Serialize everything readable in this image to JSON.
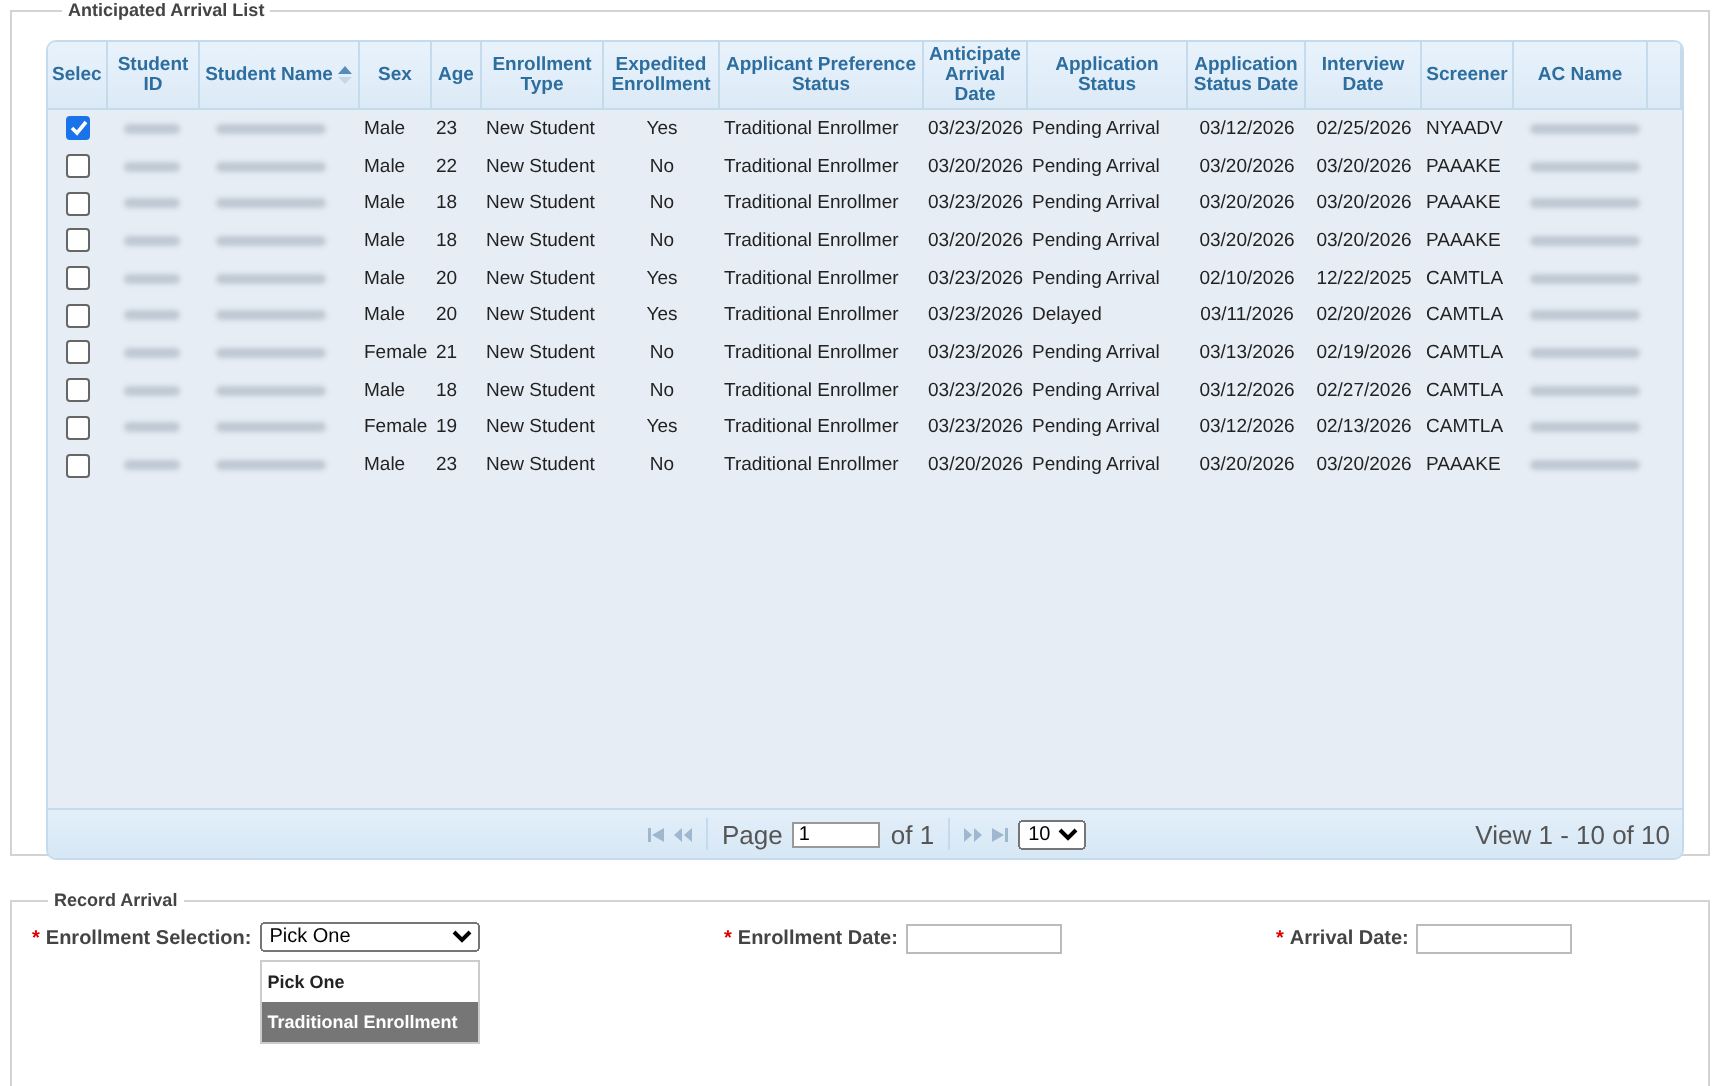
{
  "arrival_list": {
    "legend": "Anticipated Arrival List",
    "columns": [
      {
        "label": "Selec",
        "sorted": false
      },
      {
        "label": "Student ID",
        "sorted": false
      },
      {
        "label": "Student Name",
        "sorted": true
      },
      {
        "label": "Sex",
        "sorted": false
      },
      {
        "label": "Age",
        "sorted": false
      },
      {
        "label": "Enrollment Type",
        "sorted": false
      },
      {
        "label": "Expedited Enrollment",
        "sorted": false
      },
      {
        "label": "Applicant Preference Status",
        "sorted": false
      },
      {
        "label": "Anticipate Arrival Date",
        "sorted": false
      },
      {
        "label": "Application Status",
        "sorted": false
      },
      {
        "label": "Application Status Date",
        "sorted": false
      },
      {
        "label": "Interview Date",
        "sorted": false
      },
      {
        "label": "Screener",
        "sorted": false
      },
      {
        "label": "AC Name",
        "sorted": false
      }
    ],
    "rows": [
      {
        "checked": true,
        "sex": "Male",
        "age": "23",
        "enrollment_type": "New Student",
        "expedited": "Yes",
        "preference_status": "Traditional Enrollmer",
        "arrival_date": "03/23/2026",
        "application_status": "Pending Arrival",
        "status_date": "03/12/2026",
        "interview_date": "02/25/2026",
        "screener": "NYAADV"
      },
      {
        "checked": false,
        "sex": "Male",
        "age": "22",
        "enrollment_type": "New Student",
        "expedited": "No",
        "preference_status": "Traditional Enrollmer",
        "arrival_date": "03/20/2026",
        "application_status": "Pending Arrival",
        "status_date": "03/20/2026",
        "interview_date": "03/20/2026",
        "screener": "PAAAKE"
      },
      {
        "checked": false,
        "sex": "Male",
        "age": "18",
        "enrollment_type": "New Student",
        "expedited": "No",
        "preference_status": "Traditional Enrollmer",
        "arrival_date": "03/23/2026",
        "application_status": "Pending Arrival",
        "status_date": "03/20/2026",
        "interview_date": "03/20/2026",
        "screener": "PAAAKE"
      },
      {
        "checked": false,
        "sex": "Male",
        "age": "18",
        "enrollment_type": "New Student",
        "expedited": "No",
        "preference_status": "Traditional Enrollmer",
        "arrival_date": "03/20/2026",
        "application_status": "Pending Arrival",
        "status_date": "03/20/2026",
        "interview_date": "03/20/2026",
        "screener": "PAAAKE"
      },
      {
        "checked": false,
        "sex": "Male",
        "age": "20",
        "enrollment_type": "New Student",
        "expedited": "Yes",
        "preference_status": "Traditional Enrollmer",
        "arrival_date": "03/23/2026",
        "application_status": "Pending Arrival",
        "status_date": "02/10/2026",
        "interview_date": "12/22/2025",
        "screener": "CAMTLA"
      },
      {
        "checked": false,
        "sex": "Male",
        "age": "20",
        "enrollment_type": "New Student",
        "expedited": "Yes",
        "preference_status": "Traditional Enrollmer",
        "arrival_date": "03/23/2026",
        "application_status": "Delayed",
        "status_date": "03/11/2026",
        "interview_date": "02/20/2026",
        "screener": "CAMTLA"
      },
      {
        "checked": false,
        "sex": "Female",
        "age": "21",
        "enrollment_type": "New Student",
        "expedited": "No",
        "preference_status": "Traditional Enrollmer",
        "arrival_date": "03/23/2026",
        "application_status": "Pending Arrival",
        "status_date": "03/13/2026",
        "interview_date": "02/19/2026",
        "screener": "CAMTLA"
      },
      {
        "checked": false,
        "sex": "Male",
        "age": "18",
        "enrollment_type": "New Student",
        "expedited": "No",
        "preference_status": "Traditional Enrollmer",
        "arrival_date": "03/23/2026",
        "application_status": "Pending Arrival",
        "status_date": "03/12/2026",
        "interview_date": "02/27/2026",
        "screener": "CAMTLA"
      },
      {
        "checked": false,
        "sex": "Female",
        "age": "19",
        "enrollment_type": "New Student",
        "expedited": "Yes",
        "preference_status": "Traditional Enrollmer",
        "arrival_date": "03/23/2026",
        "application_status": "Pending Arrival",
        "status_date": "03/12/2026",
        "interview_date": "02/13/2026",
        "screener": "CAMTLA"
      },
      {
        "checked": false,
        "sex": "Male",
        "age": "23",
        "enrollment_type": "New Student",
        "expedited": "No",
        "preference_status": "Traditional Enrollmer",
        "arrival_date": "03/20/2026",
        "application_status": "Pending Arrival",
        "status_date": "03/20/2026",
        "interview_date": "03/20/2026",
        "screener": "PAAAKE"
      }
    ],
    "pager": {
      "page_label": "Page",
      "page_value": "1",
      "of_label": "of 1",
      "page_size": "10",
      "summary": "View 1 - 10 of 10"
    }
  },
  "record_arrival": {
    "legend": "Record Arrival",
    "fields": [
      {
        "kind": "select",
        "label": "Enrollment Selection:",
        "marker": "*",
        "value": "Pick One",
        "options": [
          {
            "label": "Pick One",
            "highlighted": false
          },
          {
            "label": "Traditional Enrollment",
            "highlighted": true
          }
        ]
      },
      {
        "kind": "date",
        "label": "Enrollment Date:",
        "marker": "*"
      },
      {
        "kind": "date",
        "label": "Arrival Date:",
        "marker": "*"
      }
    ]
  }
}
